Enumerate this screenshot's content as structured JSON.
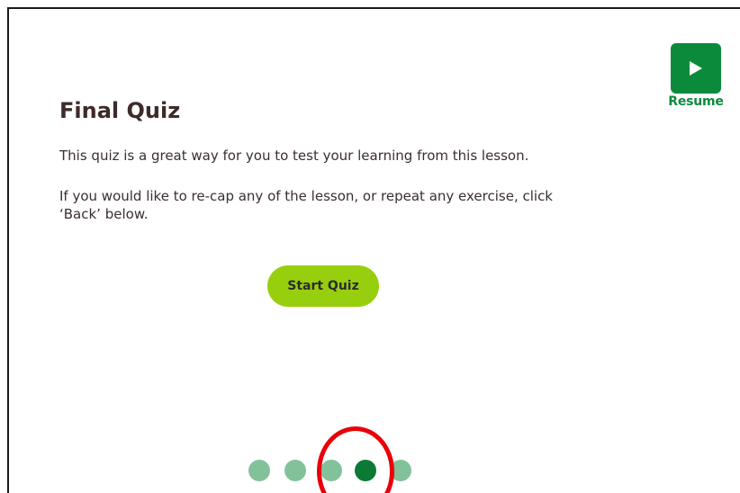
{
  "resume": {
    "label": "Resume",
    "icon": "play-icon",
    "color": "#0b8a3c"
  },
  "content": {
    "title": "Final Quiz",
    "paragraphs": [
      "This quiz is a great way for you to test your learning from this lesson.",
      "If you would like to re-cap any of the lesson, or repeat any exercise, click ‘Back’ below."
    ],
    "start_button": {
      "label": "Start Quiz",
      "color": "#97cf0f"
    }
  },
  "pagination": {
    "total_pages": 5,
    "current_page": 4,
    "active_color": "#0b7a34",
    "inactive_color": "#82c29a"
  },
  "annotation": {
    "shape": "circle",
    "color": "#e8000a",
    "target": "pagination-dot-4"
  }
}
